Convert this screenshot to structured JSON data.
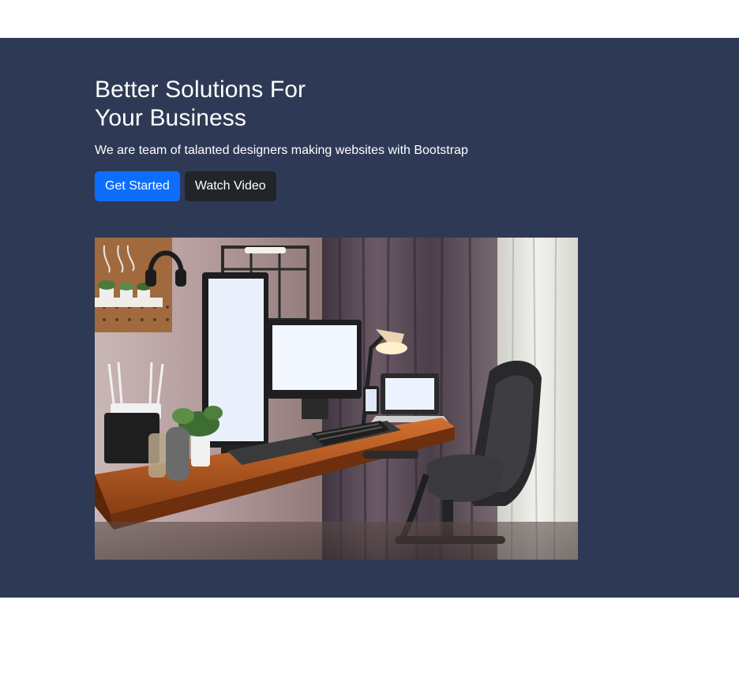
{
  "hero": {
    "title_line1": "Better Solutions For",
    "title_line2": "Your Business",
    "subtitle": "We are team of talanted designers making websites with Bootstrap",
    "buttons": {
      "get_started": "Get Started",
      "watch_video": "Watch Video"
    },
    "image": {
      "alt": "Desk setup with monitors, laptop, keyboard, lamp and office chair"
    }
  },
  "colors": {
    "hero_background": "#2e3a55",
    "primary": "#0d6efd",
    "dark": "#212529"
  }
}
